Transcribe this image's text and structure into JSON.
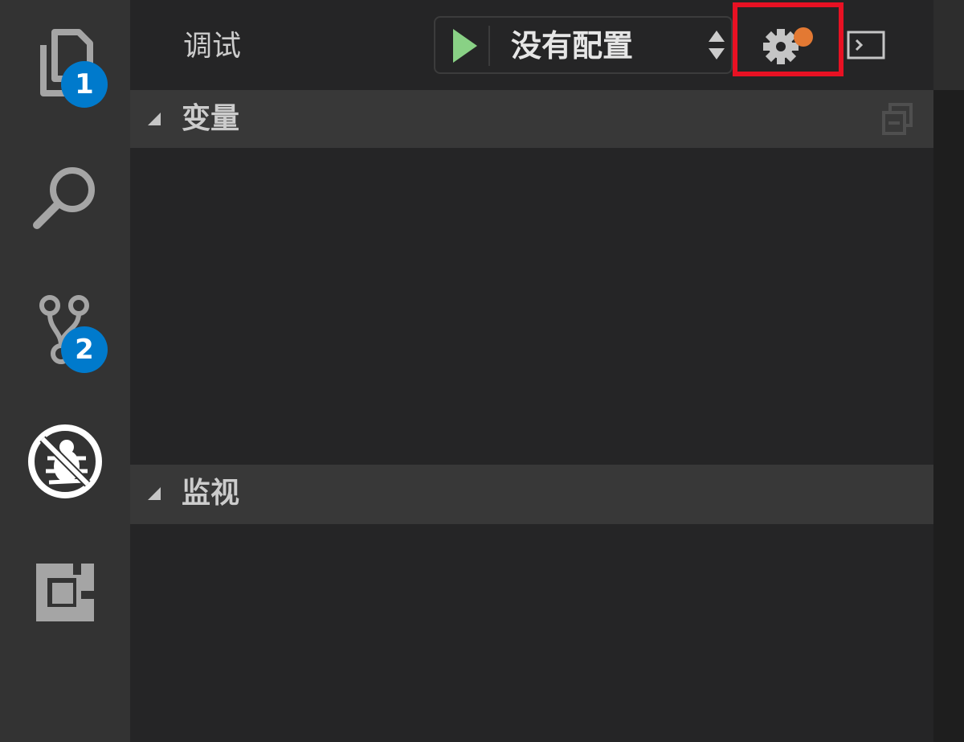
{
  "activity_bar": {
    "items": [
      {
        "icon": "files-icon",
        "badge": "1"
      },
      {
        "icon": "search-icon"
      },
      {
        "icon": "source-control-icon",
        "badge": "2"
      },
      {
        "icon": "debug-icon"
      },
      {
        "icon": "extensions-icon"
      }
    ]
  },
  "debug_header": {
    "title": "调试",
    "config_select": {
      "value": "没有配置"
    },
    "icons": {
      "start": "play-icon",
      "select_arrows": "updown-arrows-icon",
      "settings": "gear-icon",
      "console": "terminal-icon"
    }
  },
  "sections": [
    {
      "title": "变量",
      "action_icon": "collapse-all-icon"
    },
    {
      "title": "监视"
    }
  ],
  "colors": {
    "accent_badge": "#007acc",
    "play": "#89d185",
    "settings_dot": "#e37933",
    "highlight": "#e81123"
  }
}
